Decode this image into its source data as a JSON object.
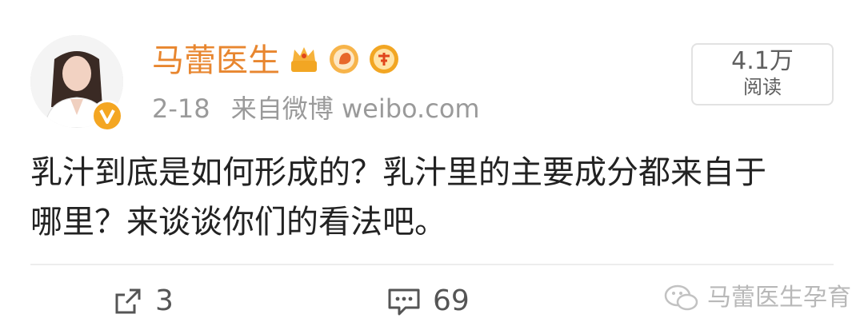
{
  "post": {
    "author": "马蕾医生",
    "date": "2-18",
    "source": "来自微博 weibo.com",
    "reads_count": "4.1万",
    "reads_label": "阅读",
    "text_line1": "乳汁到底是如何形成的？乳汁里的主要成分都来自于",
    "text_line2": "哪里？来谈谈你们的看法吧。"
  },
  "actions": {
    "repost_count": "3",
    "comment_count": "69"
  },
  "watermark": {
    "text": "马蕾医生孕育"
  },
  "colors": {
    "username": "#e8862f",
    "meta": "#9a9a9a",
    "text": "#222222",
    "badge_gold": "#f4a622"
  },
  "icons": [
    "verified-v-icon",
    "crown-badge-icon",
    "bird-badge-icon",
    "medal-badge-icon",
    "repost-icon",
    "comment-icon",
    "wechat-icon"
  ]
}
